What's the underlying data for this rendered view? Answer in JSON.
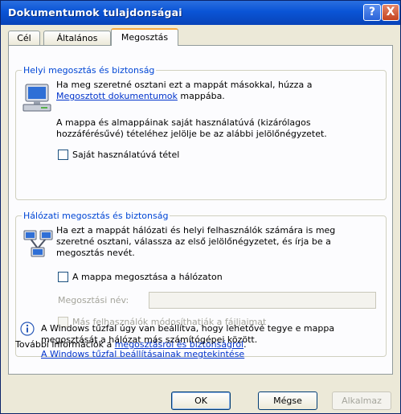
{
  "window": {
    "title": "Dokumentumok tulajdonságai",
    "help_label": "?",
    "close_label": "X"
  },
  "tabs": [
    {
      "label": "Cél"
    },
    {
      "label": "Általános"
    },
    {
      "label": "Megosztás",
      "active": true
    }
  ],
  "local_sharing": {
    "title": "Helyi megosztás és biztonság",
    "text1": "Ha meg szeretné osztani ezt a mappát másokkal, húzza a",
    "link": "Megosztott dokumentumok",
    "text1_end": "mappába.",
    "text2_line1": "A mappa és almappáinak saját használatúvá (kizárólagos",
    "text2_line2": "hozzáférésűvé) tételéhez jelölje be az alábbi jelölőnégyzetet.",
    "checkbox_label": "Saját használatúvá tétel",
    "checkbox_checked": false
  },
  "network_sharing": {
    "title": "Hálózati megosztás és biztonság",
    "text_line1": "Ha ezt a mappát hálózati és helyi felhasználók számára is meg",
    "text_line2": "szeretné osztani, válassza az első jelölőnégyzetet, és írja be a",
    "text_line3": "megosztás nevét.",
    "share_checkbox_label": "A mappa megosztása a hálózaton",
    "share_checkbox_checked": false,
    "share_name_label": "Megosztási név:",
    "share_name_value": "",
    "modify_checkbox_label": "Más felhasználók módosíthatják a fájljaimat",
    "modify_checkbox_enabled": false
  },
  "more_info": {
    "prefix": "További információk a",
    "link": "megosztásról és biztonságról",
    "suffix": "."
  },
  "firewall": {
    "text_line1": "A Windows tűzfal úgy van beállítva, hogy lehetővé tegye e mappa",
    "text_line2": "megosztását a hálózat más számítógépei között.",
    "link": "A Windows tűzfal beállításainak megtekintése"
  },
  "buttons": {
    "ok": "OK",
    "cancel": "Mégse",
    "apply": "Alkalmaz"
  },
  "colors": {
    "title_bar": "#0a54d6",
    "group_title": "#0046d5",
    "link": "#0033cc",
    "dialog_bg": "#ece9d8",
    "disabled_text": "#a5a59c"
  }
}
